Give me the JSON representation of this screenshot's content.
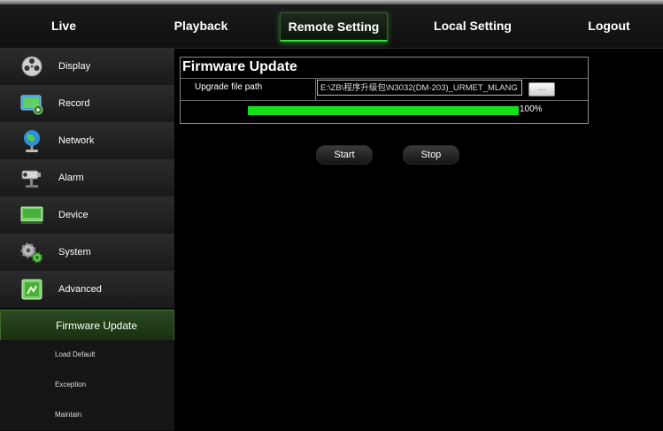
{
  "nav": {
    "items": [
      {
        "label": "Live"
      },
      {
        "label": "Playback"
      },
      {
        "label": "Remote Setting",
        "active": true
      },
      {
        "label": "Local Setting"
      },
      {
        "label": "Logout"
      }
    ]
  },
  "sidebar": {
    "items": [
      {
        "label": "Display",
        "icon": "film-reel-icon"
      },
      {
        "label": "Record",
        "icon": "record-monitor-icon"
      },
      {
        "label": "Network",
        "icon": "globe-network-icon"
      },
      {
        "label": "Alarm",
        "icon": "cctv-camera-icon"
      },
      {
        "label": "Device",
        "icon": "hard-drive-icon"
      },
      {
        "label": "System",
        "icon": "gears-icon"
      },
      {
        "label": "Advanced",
        "icon": "advanced-settings-icon"
      }
    ],
    "sub_items": [
      {
        "label": "Firmware Update",
        "active": true
      },
      {
        "label": "Load Default"
      },
      {
        "label": "Exception"
      },
      {
        "label": "Maintain"
      }
    ]
  },
  "firmware": {
    "title": "Firmware Update",
    "path_label": "Upgrade file path",
    "path_value": "E:\\ZB\\程序升级包\\N3032(DM-203)_URMET_MLANG",
    "browse_label": "....",
    "progress": 1.0,
    "progress_text": "100%"
  },
  "actions": {
    "start_label": "Start",
    "stop_label": "Stop"
  },
  "colors": {
    "accent_green": "#14e01a",
    "active_tab_glow": "#3bdc3b",
    "active_sub_bg": "#2b4a22"
  }
}
